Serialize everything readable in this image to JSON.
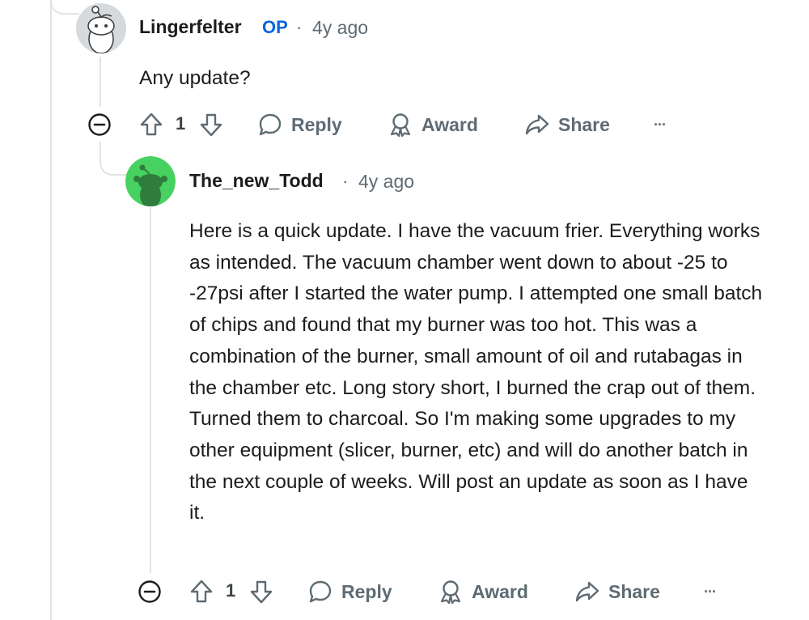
{
  "thread": {
    "comment1": {
      "author": "Lingerfelter",
      "op_badge": "OP",
      "separator": "·",
      "time": "4y ago",
      "body": "Any update?",
      "votes": "1",
      "actions": {
        "reply": "Reply",
        "award": "Award",
        "share": "Share",
        "more": "···"
      }
    },
    "comment2": {
      "author": "The_new_Todd",
      "separator": "·",
      "time": "4y ago",
      "body": "Here is a quick update. I have the vacuum frier. Everything works as intended. The vacuum chamber went down to about -25 to -27psi after I started the water pump. I attempted one small batch of chips and found that my burner was too hot. This was a combination of the burner, small amount of oil and rutabagas in the chamber etc. Long story short, I burned the crap out of them. Turned them to charcoal. So I'm making some upgrades to my other equipment (slicer, burner, etc) and will do another batch in the next couple of weeks. Will post an update as soon as I have it.",
      "votes": "1",
      "actions": {
        "reply": "Reply",
        "award": "Award",
        "share": "Share",
        "more": "···"
      }
    }
  },
  "icons": {
    "collapse": "minus-circle-icon",
    "upvote": "arrow-up-icon",
    "downvote": "arrow-down-icon",
    "reply": "speech-bubble-icon",
    "award": "award-ribbon-icon",
    "share": "share-arrow-icon",
    "more": "ellipsis-icon"
  },
  "colors": {
    "op_badge": "#0a65d8",
    "meta_text": "#5e6b73",
    "thread_line": "#e3e3e3",
    "avatar2_bg": "#46d160"
  }
}
